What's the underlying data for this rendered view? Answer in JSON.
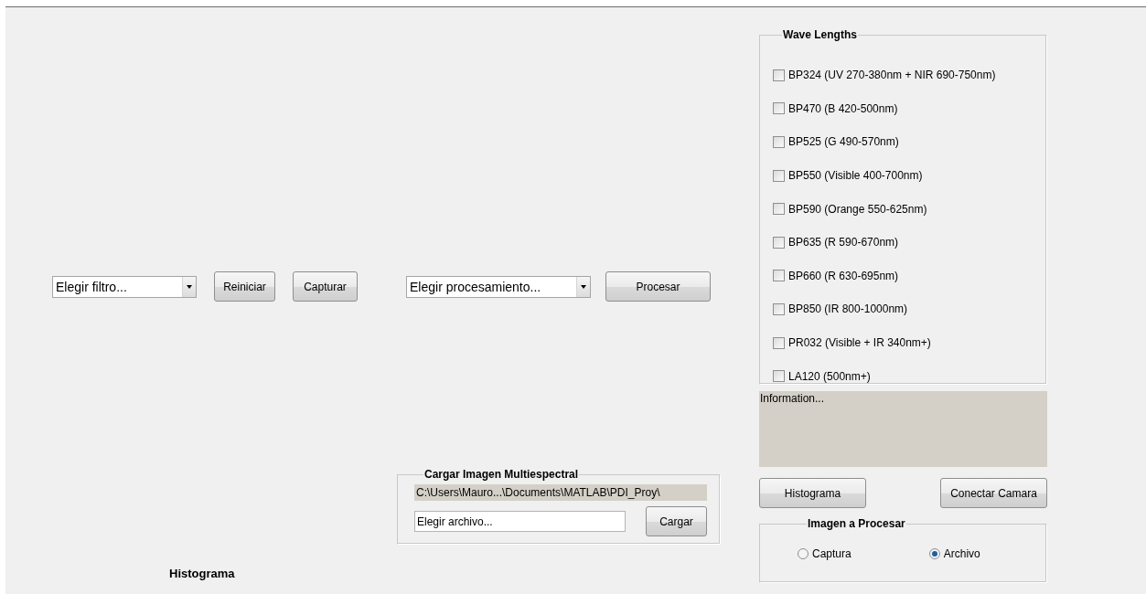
{
  "controls": {
    "filter_select": {
      "value": "Elegir filtro..."
    },
    "reset_button": "Reiniciar",
    "capture_button": "Capturar",
    "process_select": {
      "value": "Elegir procesamiento..."
    },
    "process_button": "Procesar"
  },
  "load_panel": {
    "title": "Cargar Imagen Multiespectral",
    "path": "C:\\Users\\Mauro...\\Documents\\MATLAB\\PDI_Proy\\",
    "file_field": {
      "value": "Elegir archivo..."
    },
    "load_button": "Cargar"
  },
  "histogram_label": "Histograma",
  "wave_lengths": {
    "title": "Wave Lengths",
    "items": [
      {
        "label": "BP324 (UV 270-380nm + NIR 690-750nm)",
        "checked": false
      },
      {
        "label": "BP470 (B 420-500nm)",
        "checked": false
      },
      {
        "label": "BP525 (G 490-570nm)",
        "checked": false
      },
      {
        "label": "BP550 (Visible 400-700nm)",
        "checked": false
      },
      {
        "label": "BP590 (Orange 550-625nm)",
        "checked": false
      },
      {
        "label": "BP635 (R 590-670nm)",
        "checked": false
      },
      {
        "label": "BP660 (R 630-695nm)",
        "checked": false
      },
      {
        "label": "BP850 (IR 800-1000nm)",
        "checked": false
      },
      {
        "label": "PR032 (Visible + IR 340nm+)",
        "checked": false
      },
      {
        "label": "LA120 (500nm+)",
        "checked": false
      }
    ]
  },
  "information": "Information...",
  "side_buttons": [
    "Histograma",
    "Conectar Camara"
  ],
  "image_source": {
    "title": "Imagen a Procesar",
    "options": [
      {
        "label": "Captura",
        "selected": false
      },
      {
        "label": "Archivo",
        "selected": true
      }
    ]
  }
}
